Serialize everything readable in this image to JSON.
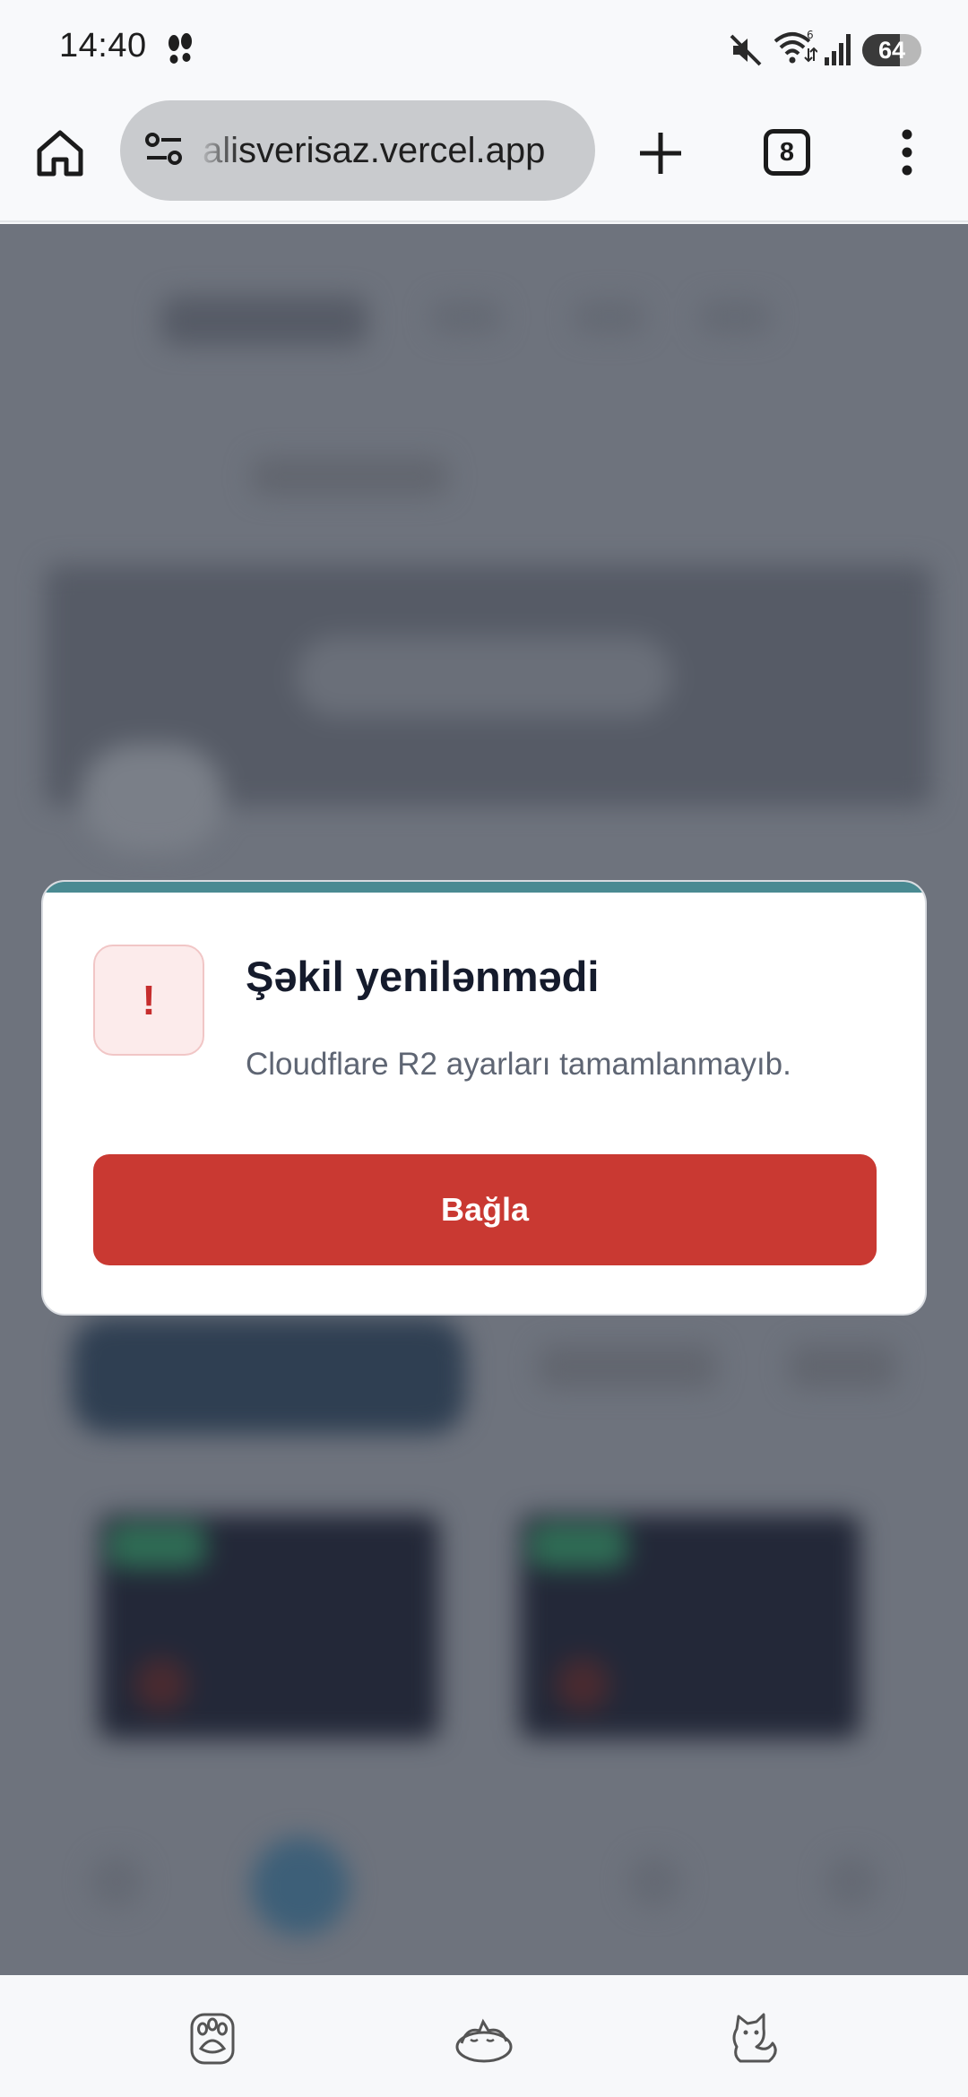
{
  "status_bar": {
    "time": "14:40",
    "battery": "64",
    "battery_fraction": 0.64,
    "wifi_badge": "6"
  },
  "browser": {
    "url": "alisverisaz.vercel.app",
    "tab_count": "8"
  },
  "dialog": {
    "icon": "!",
    "title": "Şəkil yenilənmədi",
    "message": "Cloudflare R2 ayarları tamamlanmayıb.",
    "close_label": "Bağla"
  },
  "colors": {
    "accent": "#4a8a92",
    "danger": "#c93932",
    "alert_bg": "#fcebeb"
  },
  "bottom_nav": {
    "items": [
      "paw-icon",
      "sleeping-cat-icon",
      "cat-icon"
    ]
  }
}
